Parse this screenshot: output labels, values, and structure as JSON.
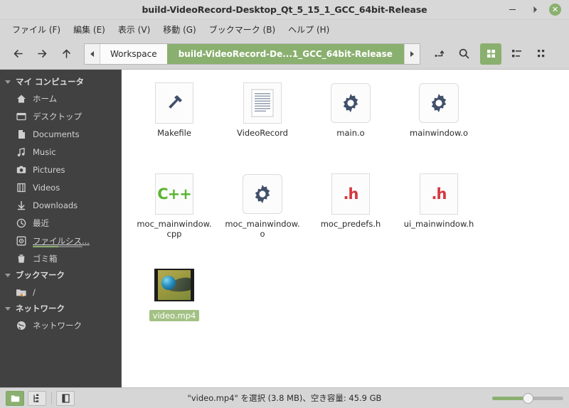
{
  "window": {
    "title": "build-VideoRecord-Desktop_Qt_5_15_1_GCC_64bit-Release",
    "minimize_label": "−",
    "restore_label": "◩",
    "close_label": "✕"
  },
  "menubar": {
    "items": [
      {
        "label": "ファイル (F)"
      },
      {
        "label": "編集 (E)"
      },
      {
        "label": "表示 (V)"
      },
      {
        "label": "移動 (G)"
      },
      {
        "label": "ブックマーク (B)"
      },
      {
        "label": "ヘルプ (H)"
      }
    ]
  },
  "toolbar": {
    "back_icon": "arrow-left-icon",
    "forward_icon": "arrow-right-icon",
    "up_icon": "arrow-up-icon",
    "breadcrumbs": [
      {
        "label": "Workspace",
        "active": false
      },
      {
        "label": "build-VideoRecord-De...1_GCC_64bit-Release",
        "active": true
      }
    ],
    "terminal_icon": "terminal-icon",
    "search_icon": "search-icon",
    "views": [
      {
        "name": "icon-view",
        "active": true
      },
      {
        "name": "compact-view",
        "active": false
      },
      {
        "name": "detail-view",
        "active": false
      }
    ]
  },
  "sidebar": {
    "groups": [
      {
        "label": "マイ コンピュータ",
        "items": [
          {
            "label": "ホーム",
            "icon": "home-icon",
            "selected": false
          },
          {
            "label": "デスクトップ",
            "icon": "desktop-icon",
            "selected": false
          },
          {
            "label": "Documents",
            "icon": "document-icon",
            "selected": false
          },
          {
            "label": "Music",
            "icon": "music-note-icon",
            "selected": false
          },
          {
            "label": "Pictures",
            "icon": "camera-icon",
            "selected": false
          },
          {
            "label": "Videos",
            "icon": "film-icon",
            "selected": false
          },
          {
            "label": "Downloads",
            "icon": "download-arrow-icon",
            "selected": false
          },
          {
            "label": "最近",
            "icon": "clock-icon",
            "selected": false
          },
          {
            "label": "ファイルシス...",
            "icon": "filesystem-disk-icon",
            "selected": true,
            "usage_percent": 52
          },
          {
            "label": "ゴミ箱",
            "icon": "trash-icon",
            "selected": false
          }
        ]
      },
      {
        "label": "ブックマーク",
        "items": [
          {
            "label": "/",
            "icon": "folder-warning-icon",
            "selected": false
          }
        ]
      },
      {
        "label": "ネットワーク",
        "items": [
          {
            "label": "ネットワーク",
            "icon": "globe-icon",
            "selected": false
          }
        ]
      }
    ]
  },
  "files": [
    {
      "name": "Makefile",
      "icon": "hammer-icon",
      "selected": false
    },
    {
      "name": "VideoRecord",
      "icon": "text-document-icon",
      "selected": false
    },
    {
      "name": "main.o",
      "icon": "gear-icon",
      "selected": false
    },
    {
      "name": "mainwindow.o",
      "icon": "gear-icon",
      "selected": false
    },
    {
      "name": "moc_mainwindow.cpp",
      "icon": "cpp-icon",
      "badge": "C++",
      "selected": false
    },
    {
      "name": "moc_mainwindow.o",
      "icon": "gear-icon",
      "selected": false
    },
    {
      "name": "moc_predefs.h",
      "icon": "header-icon",
      "badge": ".h",
      "selected": false
    },
    {
      "name": "ui_mainwindow.h",
      "icon": "header-icon",
      "badge": ".h",
      "selected": false
    },
    {
      "name": "video.mp4",
      "icon": "video-thumbnail",
      "selected": true
    }
  ],
  "statusbar": {
    "buttons": [
      {
        "name": "icon-view-toggle",
        "icon": "folder-icon",
        "active": true
      },
      {
        "name": "tree-view-toggle",
        "icon": "tree-icon",
        "active": false
      },
      {
        "name": "sidebar-toggle",
        "icon": "panel-icon",
        "active": false
      }
    ],
    "text": "\"video.mp4\" を選択 (3.8 MB)、空き容量: 45.9 GB",
    "zoom_percent": 50
  },
  "colors": {
    "accent_green": "#8ab06f",
    "sidebar_bg": "#414141",
    "chrome_bg": "#d6d6d6",
    "header_red": "#d8373f",
    "cpp_green": "#5bb532"
  }
}
